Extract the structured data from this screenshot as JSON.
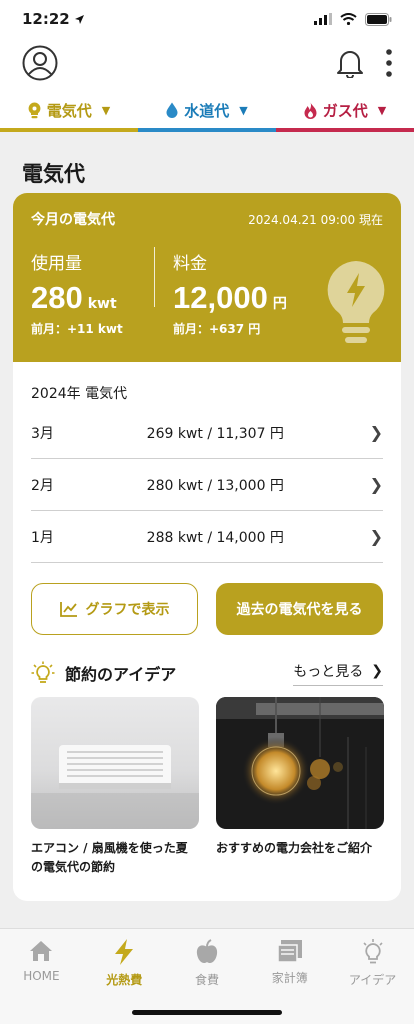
{
  "status_bar": {
    "time": "12:22"
  },
  "tabs": [
    {
      "label": "電気代",
      "color": "#b49a14"
    },
    {
      "label": "水道代",
      "color": "#1b7cb8"
    },
    {
      "label": "ガス代",
      "color": "#b61f43"
    }
  ],
  "section_title": "電気代",
  "summary": {
    "label": "今月の電気代",
    "date": "2024.04.21 09:00 現在",
    "usage": {
      "label": "使用量",
      "value": "280",
      "unit": "kwt",
      "prev": "前月：+11 kwt"
    },
    "fee": {
      "label": "料金",
      "value": "12,000",
      "unit": "円",
      "prev": "前月：+637 円"
    }
  },
  "history": {
    "title": "2024年 電気代",
    "rows": [
      {
        "month": "3月",
        "value": "269 kwt / 11,307 円"
      },
      {
        "month": "2月",
        "value": "280 kwt / 13,000 円"
      },
      {
        "month": "1月",
        "value": "288 kwt / 14,000 円"
      }
    ]
  },
  "buttons": {
    "graph": "グラフで表示",
    "past": "過去の電気代を見る"
  },
  "ideas": {
    "title": "節約のアイデア",
    "more": "もっと見る",
    "items": [
      {
        "caption": "エアコン / 扇風機を使った夏の電気代の節約"
      },
      {
        "caption": "おすすめの電力会社をご紹介"
      }
    ]
  },
  "tabbar": [
    {
      "label": "HOME",
      "icon": "home-icon"
    },
    {
      "label": "光熱費",
      "icon": "lightning-icon",
      "active": true
    },
    {
      "label": "食費",
      "icon": "apple-icon"
    },
    {
      "label": "家計簿",
      "icon": "ledger-icon"
    },
    {
      "label": "アイデア",
      "icon": "lightbulb-icon"
    }
  ],
  "colors": {
    "accent": "#b9a11f",
    "water": "#2a8ac7",
    "gas": "#c52a4e"
  }
}
